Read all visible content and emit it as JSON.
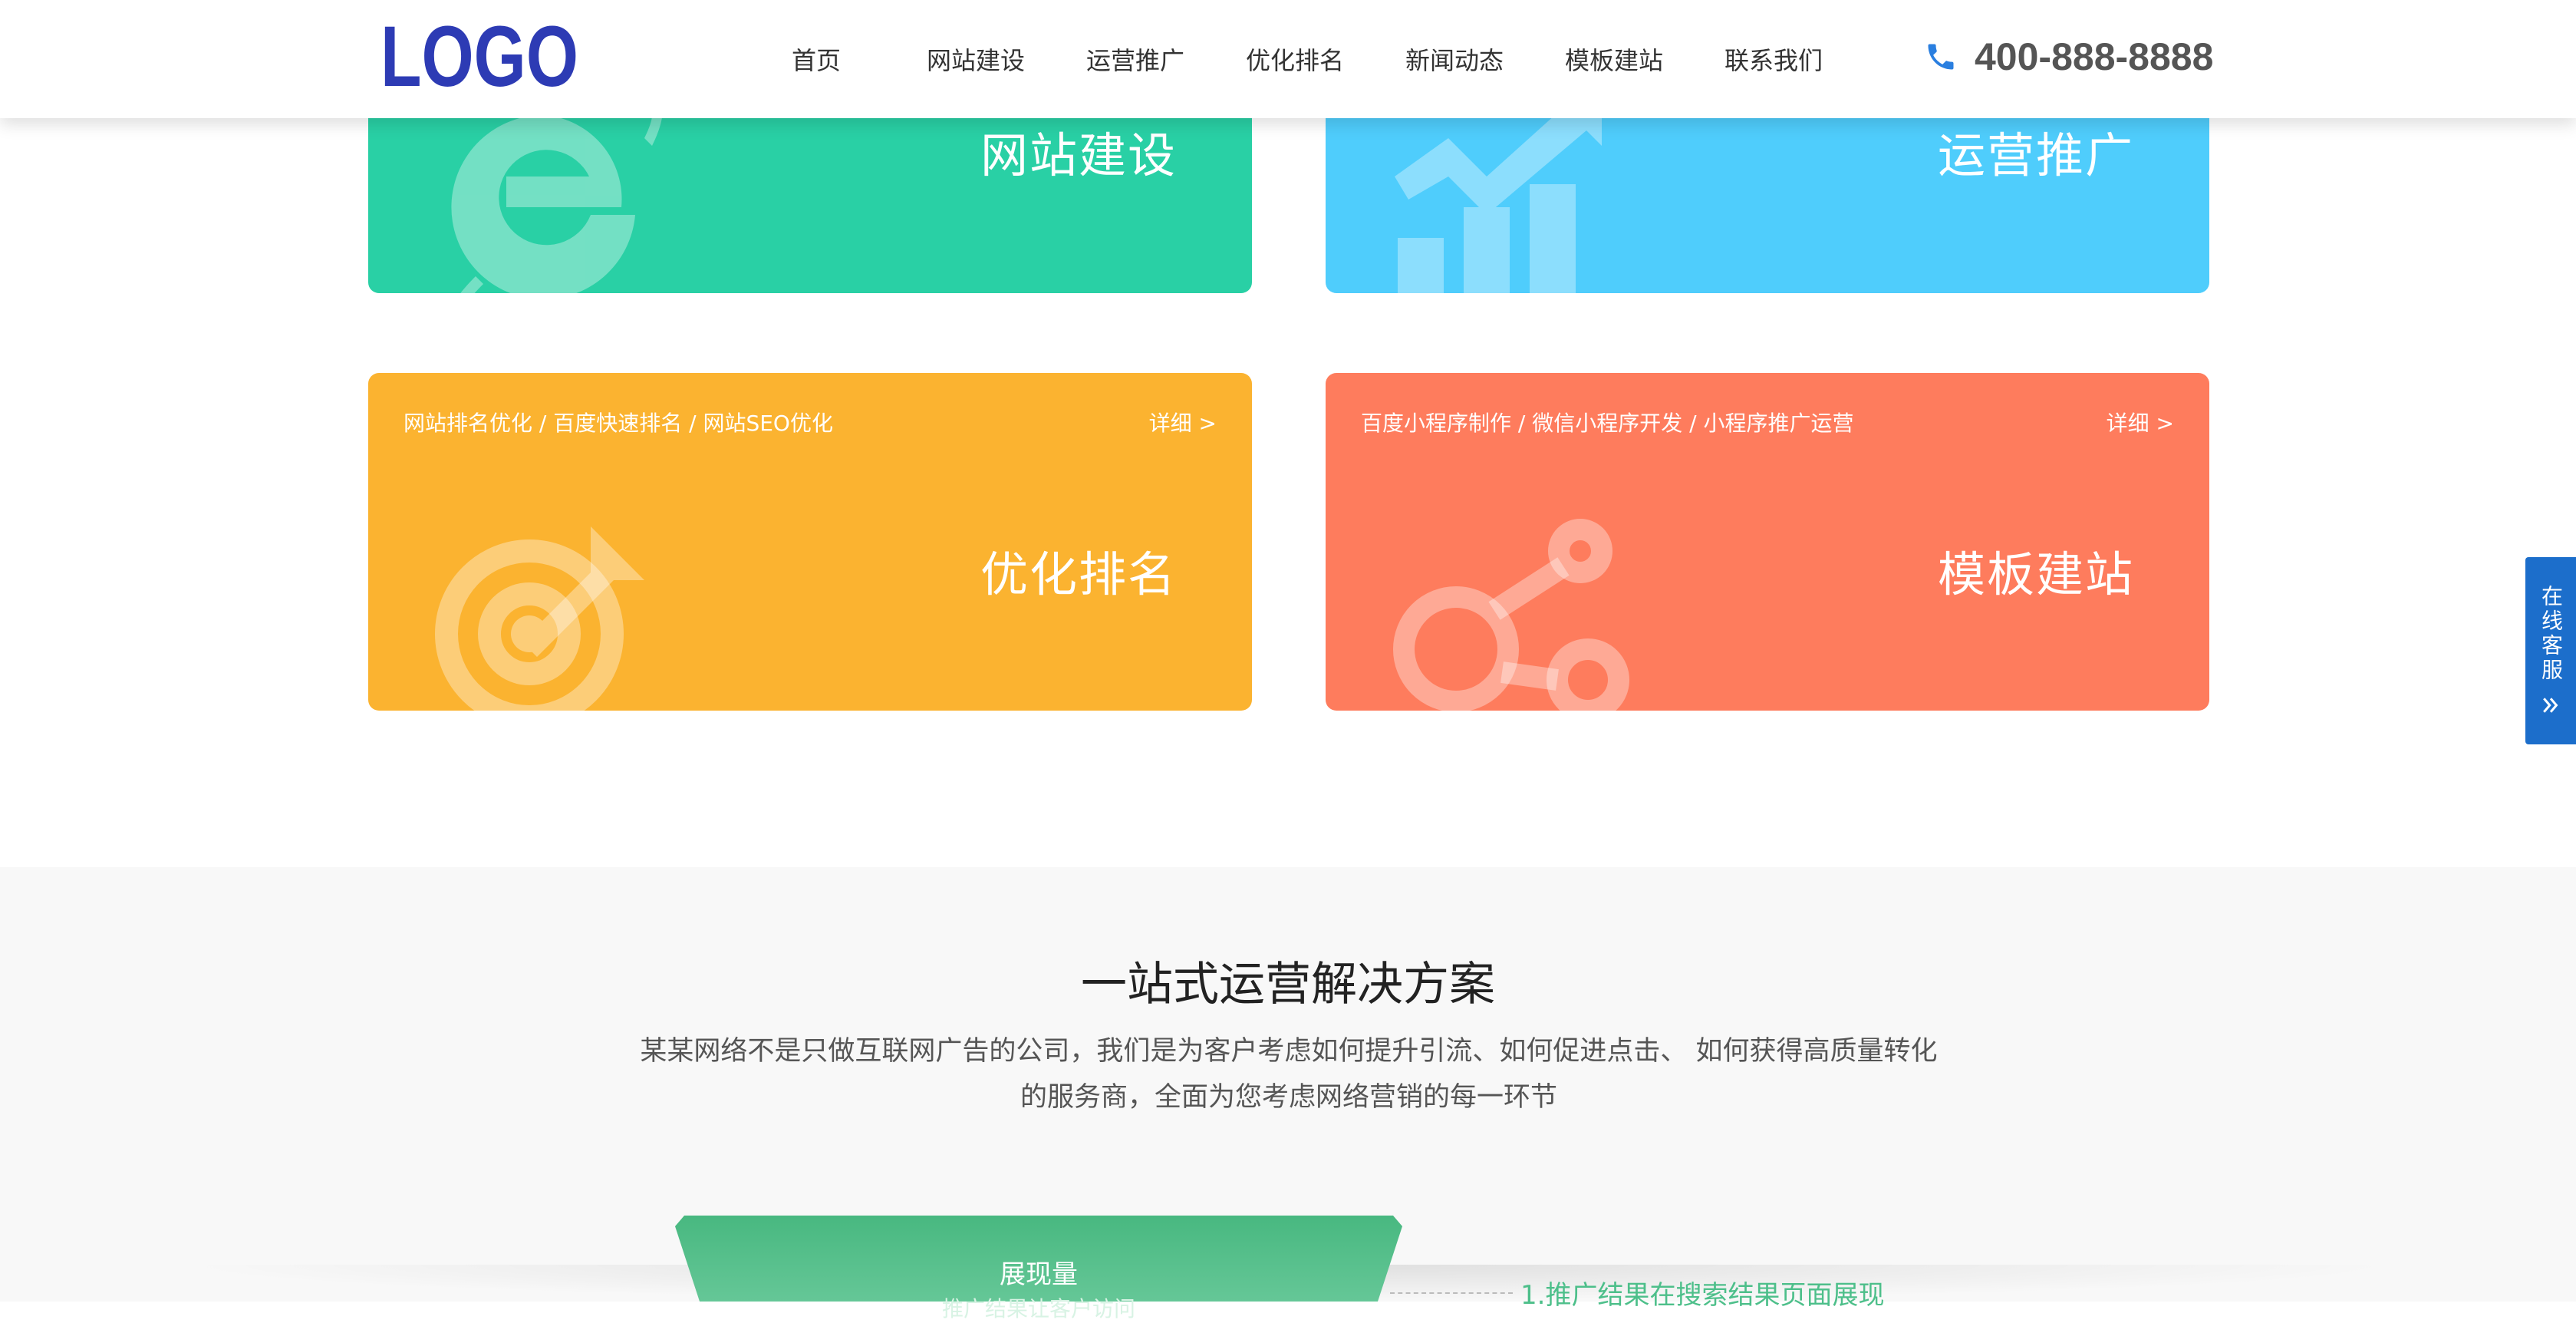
{
  "header": {
    "logo_text": "LOGO",
    "nav": [
      {
        "label": "首页",
        "active": true
      },
      {
        "label": "网站建设",
        "active": false
      },
      {
        "label": "运营推广",
        "active": false
      },
      {
        "label": "优化排名",
        "active": false
      },
      {
        "label": "新闻动态",
        "active": false
      },
      {
        "label": "模板建站",
        "active": false
      },
      {
        "label": "联系我们",
        "active": false
      }
    ],
    "phone_icon": "phone-icon",
    "phone": "400-888-8888"
  },
  "cards": [
    {
      "title": "网站建设",
      "color": "#29d0a5",
      "icon": "ie-icon"
    },
    {
      "title": "运营推广",
      "color": "#4fcdfc",
      "icon": "growth-chart-icon"
    },
    {
      "subtitle": "网站排名优化 / 百度快速排名 / 网站SEO优化",
      "more": "详细 >",
      "title": "优化排名",
      "color": "#fbb330",
      "icon": "target-icon"
    },
    {
      "subtitle": "百度小程序制作 / 微信小程序开发 / 小程序推广运营",
      "more": "详细 >",
      "title": "模板建站",
      "color": "#fe7c5d",
      "icon": "share-nodes-icon"
    }
  ],
  "solution": {
    "title": "一站式运营解决方案",
    "desc_line1": "某某网络不是只做互联网广告的公司，我们是为客户考虑如何提升引流、如何促进点击、 如何获得高质量转化",
    "desc_line2": "的服务商，全面为您考虑网络营销的每一环节",
    "funnel_label": "展现量",
    "funnel_sub": "推广结果让客户访问",
    "funnel_note": "1.推广结果在搜索结果页面展现",
    "funnel_color": "#5cc38c"
  },
  "service": {
    "label": "在线客服",
    "icon": "double-chevron-right-icon",
    "color": "#1c6ecb"
  }
}
